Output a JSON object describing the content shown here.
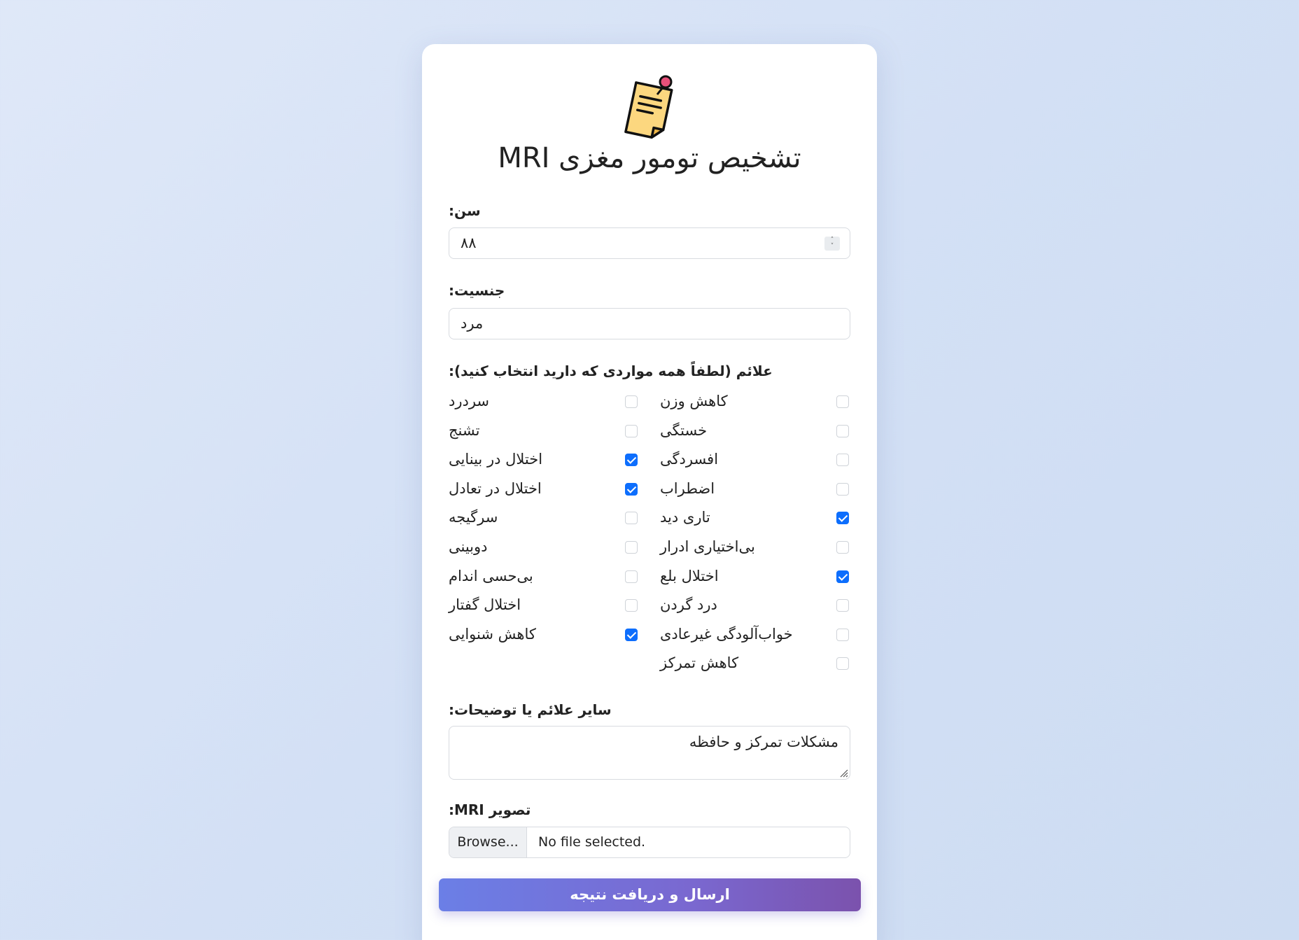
{
  "page": {
    "title": "تشخیص تومور مغزی MRI"
  },
  "age": {
    "label": ":سن",
    "value": "۸۸"
  },
  "gender": {
    "label": ":جنسیت",
    "value": "مرد"
  },
  "symptoms": {
    "label": ":علائم (لطفاً همه مواردی که دارید انتخاب کنید)",
    "left_column": [
      {
        "label": "سردرد",
        "checked": false
      },
      {
        "label": "تشنج",
        "checked": false
      },
      {
        "label": "اختلال در بینایی",
        "checked": true
      },
      {
        "label": "اختلال در تعادل",
        "checked": true
      },
      {
        "label": "سرگیجه",
        "checked": false
      },
      {
        "label": "دوبینی",
        "checked": false
      },
      {
        "label": "بی‌حسی اندام",
        "checked": false
      },
      {
        "label": "اختلال گفتار",
        "checked": false
      },
      {
        "label": "کاهش شنوایی",
        "checked": true
      }
    ],
    "right_column": [
      {
        "label": "کاهش وزن",
        "checked": false
      },
      {
        "label": "خستگی",
        "checked": false
      },
      {
        "label": "افسردگی",
        "checked": false
      },
      {
        "label": "اضطراب",
        "checked": false
      },
      {
        "label": "تاری دید",
        "checked": true
      },
      {
        "label": "بی‌اختیاری ادرار",
        "checked": false
      },
      {
        "label": "اختلال بلع",
        "checked": true
      },
      {
        "label": "درد گردن",
        "checked": false
      },
      {
        "label": "خواب‌آلودگی غیرعادی",
        "checked": false
      },
      {
        "label": "کاهش تمرکز",
        "checked": false
      }
    ]
  },
  "notes": {
    "label": ":سایر علائم یا توضیحات",
    "value": "مشکلات تمرکز و حافظه"
  },
  "mri": {
    "label": ":MRI تصویر",
    "browse_label": "Browse...",
    "status": "No file selected."
  },
  "submit": {
    "label": "ارسال و دریافت نتیجه"
  },
  "colors": {
    "accent": "#0d6efd",
    "button_start": "#6b7fe6",
    "button_end": "#7b52ad"
  }
}
